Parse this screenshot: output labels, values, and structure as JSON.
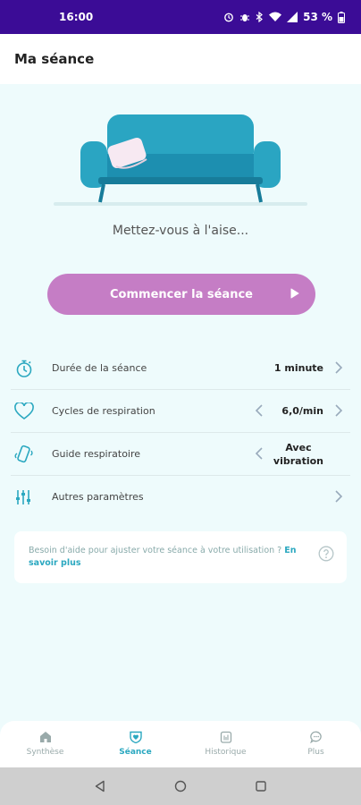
{
  "status": {
    "time": "16:00",
    "battery": "53 %"
  },
  "header": {
    "title": "Ma séance"
  },
  "hero": {
    "hint": "Mettez-vous à l'aise..."
  },
  "start_button": {
    "label": "Commencer la séance"
  },
  "settings": [
    {
      "label": "Durée de la séance",
      "value": "1 minute",
      "icon": "stopwatch-icon"
    },
    {
      "label": "Cycles de respiration",
      "value": "6,0/min",
      "icon": "heart-icon"
    },
    {
      "label": "Guide respiratoire",
      "value_line1": "Avec",
      "value_line2": "vibration",
      "icon": "vibration-icon"
    },
    {
      "label": "Autres paramètres",
      "icon": "sliders-icon"
    }
  ],
  "help": {
    "text": "Besoin d'aide pour ajuster votre séance à votre utilisation ?",
    "link_part1": "En",
    "link_part2": "savoir plus"
  },
  "nav": [
    {
      "label": "Synthèse",
      "icon": "home-icon"
    },
    {
      "label": "Séance",
      "icon": "heart-shield-icon",
      "active": true
    },
    {
      "label": "Historique",
      "icon": "calendar-icon"
    },
    {
      "label": "Plus",
      "icon": "chat-icon"
    }
  ],
  "colors": {
    "status_bar": "#3b0c96",
    "accent": "#2ba8c0",
    "start_button": "#c57dc5",
    "sofa": "#2aa5c2",
    "background": "#eefbfc"
  }
}
